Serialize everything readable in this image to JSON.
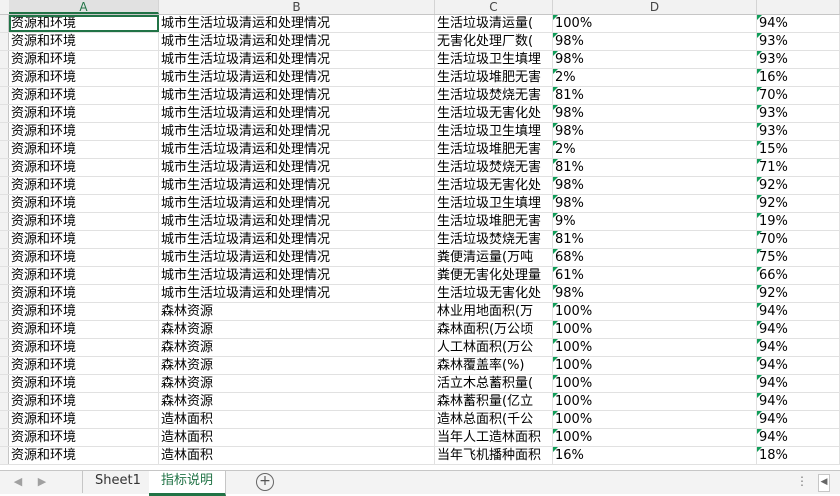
{
  "columns": [
    "A",
    "B",
    "C",
    "D",
    ""
  ],
  "rows": [
    [
      "资源和环境",
      "城市生活垃圾清运和处理情况",
      "生活垃圾清运量(",
      "100%",
      "94%"
    ],
    [
      "资源和环境",
      "城市生活垃圾清运和处理情况",
      "无害化处理厂数(",
      "98%",
      "93%"
    ],
    [
      "资源和环境",
      "城市生活垃圾清运和处理情况",
      "生活垃圾卫生填埋",
      "98%",
      "93%"
    ],
    [
      "资源和环境",
      "城市生活垃圾清运和处理情况",
      "生活垃圾堆肥无害",
      "2%",
      "16%"
    ],
    [
      "资源和环境",
      "城市生活垃圾清运和处理情况",
      "生活垃圾焚烧无害",
      "81%",
      "70%"
    ],
    [
      "资源和环境",
      "城市生活垃圾清运和处理情况",
      "生活垃圾无害化处",
      "98%",
      "93%"
    ],
    [
      "资源和环境",
      "城市生活垃圾清运和处理情况",
      "生活垃圾卫生填埋",
      "98%",
      "93%"
    ],
    [
      "资源和环境",
      "城市生活垃圾清运和处理情况",
      "生活垃圾堆肥无害",
      "2%",
      "15%"
    ],
    [
      "资源和环境",
      "城市生活垃圾清运和处理情况",
      "生活垃圾焚烧无害",
      "81%",
      "71%"
    ],
    [
      "资源和环境",
      "城市生活垃圾清运和处理情况",
      "生活垃圾无害化处",
      "98%",
      "92%"
    ],
    [
      "资源和环境",
      "城市生活垃圾清运和处理情况",
      "生活垃圾卫生填埋",
      "98%",
      "92%"
    ],
    [
      "资源和环境",
      "城市生活垃圾清运和处理情况",
      "生活垃圾堆肥无害",
      "9%",
      "19%"
    ],
    [
      "资源和环境",
      "城市生活垃圾清运和处理情况",
      "生活垃圾焚烧无害",
      "81%",
      "70%"
    ],
    [
      "资源和环境",
      "城市生活垃圾清运和处理情况",
      "粪便清运量(万吨",
      "68%",
      "75%"
    ],
    [
      "资源和环境",
      "城市生活垃圾清运和处理情况",
      "粪便无害化处理量",
      "61%",
      "66%"
    ],
    [
      "资源和环境",
      "城市生活垃圾清运和处理情况",
      "生活垃圾无害化处",
      "98%",
      "92%"
    ],
    [
      "资源和环境",
      "森林资源",
      "林业用地面积(万",
      "100%",
      "94%"
    ],
    [
      "资源和环境",
      "森林资源",
      "森林面积(万公顷",
      "100%",
      "94%"
    ],
    [
      "资源和环境",
      "森林资源",
      "人工林面积(万公",
      "100%",
      "94%"
    ],
    [
      "资源和环境",
      "森林资源",
      "森林覆盖率(%)",
      "100%",
      "94%"
    ],
    [
      "资源和环境",
      "森林资源",
      "活立木总蓄积量(",
      "100%",
      "94%"
    ],
    [
      "资源和环境",
      "森林资源",
      "森林蓄积量(亿立",
      "100%",
      "94%"
    ],
    [
      "资源和环境",
      "造林面积",
      "造林总面积(千公",
      "100%",
      "94%"
    ],
    [
      "资源和环境",
      "造林面积",
      "当年人工造林面积",
      "100%",
      "94%"
    ],
    [
      "资源和环境",
      "造林面积",
      "当年飞机播种面积",
      "16%",
      "18%"
    ]
  ],
  "tabs": [
    {
      "label": "Sheet1",
      "active": false
    },
    {
      "label": "指标说明",
      "active": true
    }
  ],
  "nav": {
    "prev": "◀",
    "next": "▶",
    "add": "+",
    "more": "⋮",
    "scroll_left": "◀"
  },
  "colors": {
    "accent": "#217346",
    "flag": "#0f9d58"
  }
}
